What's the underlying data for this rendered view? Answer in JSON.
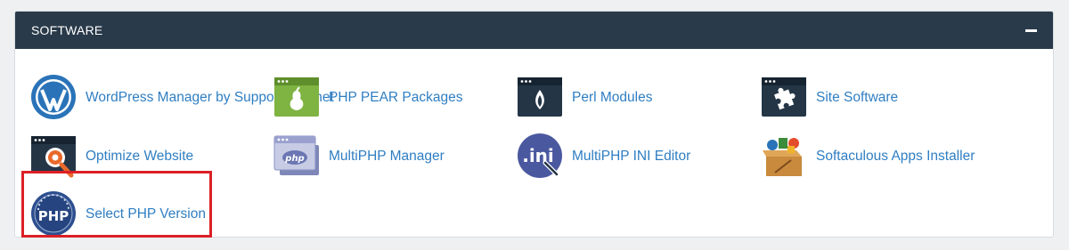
{
  "panel": {
    "title": "SOFTWARE",
    "collapse_icon": "minus-icon"
  },
  "items": [
    {
      "label": "WordPress Manager by SupportHost.net",
      "icon": "wordpress-icon"
    },
    {
      "label": "PHP PEAR Packages",
      "icon": "pear-icon"
    },
    {
      "label": "Perl Modules",
      "icon": "perl-onion-icon"
    },
    {
      "label": "Site Software",
      "icon": "puzzle-icon"
    },
    {
      "label": "Optimize Website",
      "icon": "optimize-gear-icon"
    },
    {
      "label": "MultiPHP Manager",
      "icon": "php-window-icon"
    },
    {
      "label": "MultiPHP INI Editor",
      "icon": "ini-editor-icon"
    },
    {
      "label": "Softaculous Apps Installer",
      "icon": "softaculous-box-icon"
    },
    {
      "label": "Select PHP Version",
      "icon": "php-gauge-icon",
      "highlighted": true
    }
  ],
  "colors": {
    "header_bg": "#293a4a",
    "link": "#2f7ec2",
    "highlight_border": "#dc1f26",
    "page_bg": "#eef0f2"
  }
}
